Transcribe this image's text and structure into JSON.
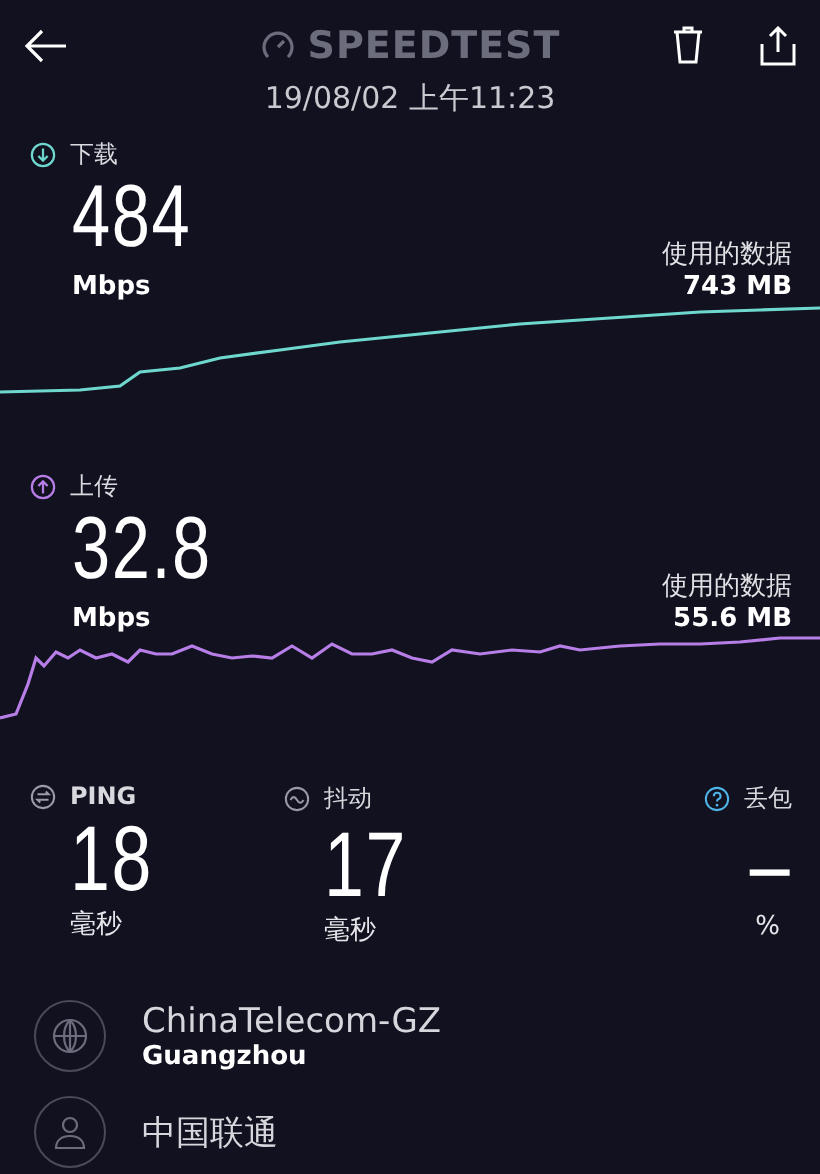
{
  "header": {
    "title": "SPEEDTEST",
    "date": "19/08/02 上午11:23"
  },
  "speeds": [
    {
      "kind": "download",
      "label": "下载",
      "value": "484",
      "unit": "Mbps",
      "data_label": "使用的数据",
      "data_value": "743 MB"
    },
    {
      "kind": "upload",
      "label": "上传",
      "value": "32.8",
      "unit": "Mbps",
      "data_label": "使用的数据",
      "data_value": "55.6 MB"
    }
  ],
  "metrics": [
    {
      "kind": "ping",
      "label": "PING",
      "value": "18",
      "unit": "毫秒"
    },
    {
      "kind": "jitter",
      "label": "抖动",
      "value": "17",
      "unit": "毫秒"
    },
    {
      "kind": "loss",
      "label": "丢包",
      "value": "–",
      "unit": "%"
    }
  ],
  "server": {
    "name": "ChinaTelecom-GZ",
    "location": "Guangzhou"
  },
  "provider": {
    "name": "中国联通"
  }
}
